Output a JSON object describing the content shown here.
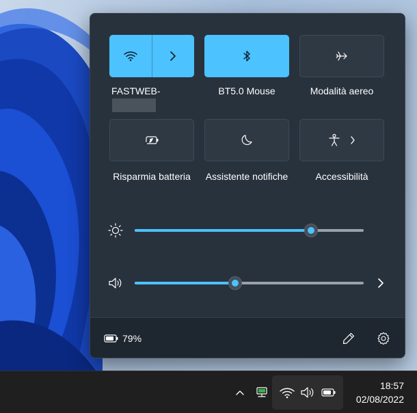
{
  "colors": {
    "accent": "#4cc2ff",
    "panel_bg": "#28323d",
    "footer_bg": "#1e262f",
    "taskbar_bg": "#1f1f1f"
  },
  "tiles": [
    {
      "label": "FASTWEB-",
      "icon": "wifi-icon",
      "active": true,
      "has_chevron": true,
      "label_redacted": true
    },
    {
      "label": "BT5.0 Mouse",
      "icon": "bluetooth-icon",
      "active": true
    },
    {
      "label": "Modalità aereo",
      "icon": "airplane-icon",
      "active": false
    },
    {
      "label": "Risparmia batteria",
      "icon": "battery-saver-icon",
      "active": false
    },
    {
      "label": "Assistente notifiche",
      "icon": "moon-icon",
      "active": false
    },
    {
      "label": "Accessibilità",
      "icon": "accessibility-icon",
      "active": false,
      "has_chevron": true
    }
  ],
  "sliders": {
    "brightness": {
      "icon": "sun-icon",
      "value": 0.77
    },
    "volume": {
      "icon": "speaker-icon",
      "value": 0.44
    }
  },
  "footer": {
    "battery_percent": "79%",
    "battery_icon": "battery-icon",
    "edit_icon": "pencil-icon",
    "settings_icon": "gear-icon"
  },
  "taskbar": {
    "time": "18:57",
    "date": "02/08/2022",
    "tray_icons": [
      "chevron-up-icon",
      "network-device-icon",
      "wifi-icon",
      "speaker-icon",
      "battery-icon"
    ]
  }
}
